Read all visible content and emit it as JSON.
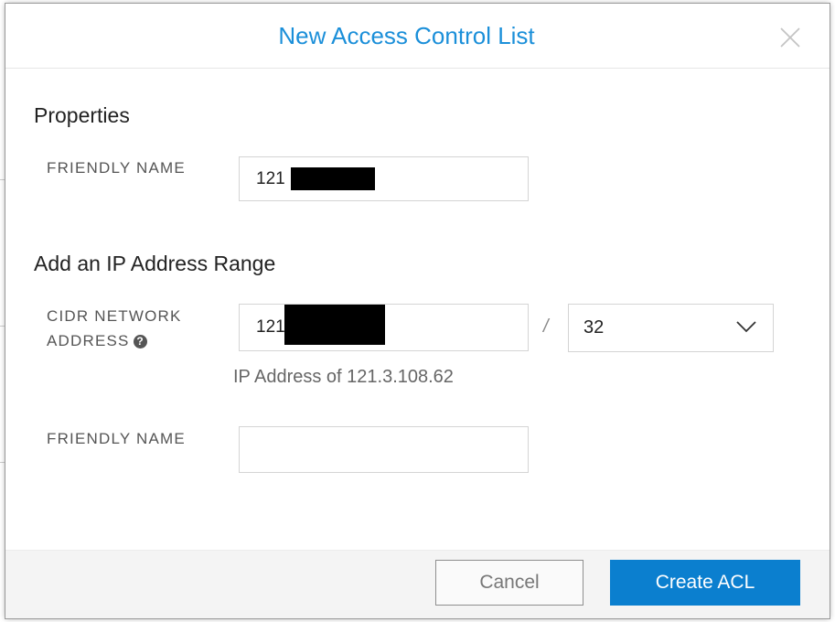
{
  "modal": {
    "title": "New Access Control List",
    "close_icon": "close-icon"
  },
  "properties": {
    "heading": "Properties",
    "friendly_name_label": "FRIENDLY NAME",
    "friendly_name_value": "121"
  },
  "ip_range": {
    "heading": "Add an IP Address Range",
    "cidr_label_line1": "CIDR NETWORK",
    "cidr_label_line2": "ADDRESS",
    "help_icon": "question-circle-icon",
    "help_glyph": "?",
    "cidr_value": "121",
    "separator": "/",
    "prefix_selected": "32",
    "hint": "IP Address of 121.3.108.62",
    "friendly_name_label": "FRIENDLY NAME",
    "friendly_name_value": ""
  },
  "footer": {
    "cancel_label": "Cancel",
    "create_label": "Create ACL"
  },
  "colors": {
    "accent": "#0b7fcf",
    "title": "#1b8fd9"
  }
}
